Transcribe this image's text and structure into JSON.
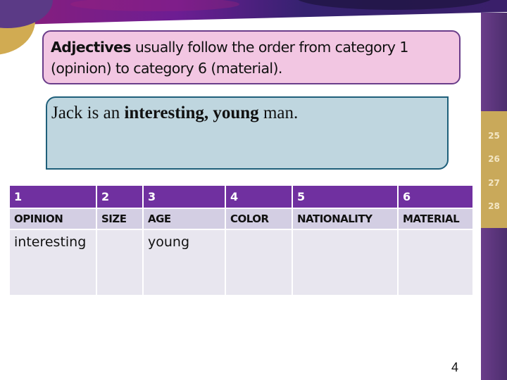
{
  "slide": {
    "rule_text": {
      "bold": "Adjectives",
      "rest": " usually follow the order from category 1 (opinion) to category 6 (material)."
    },
    "example_sentence": {
      "prefix": "Jack is an ",
      "bold": "interesting, young",
      "suffix": " man."
    },
    "table": {
      "numbers": [
        "1",
        "2",
        "3",
        "4",
        "5",
        "6"
      ],
      "categories": [
        "OPINION",
        "SIZE",
        "AGE",
        "COLOR",
        "NATIONALITY",
        "MATERIAL"
      ],
      "words": [
        "interesting",
        "",
        "young",
        "",
        "",
        ""
      ]
    },
    "page_number": "4"
  },
  "sidebar": {
    "numbers": [
      "25",
      "26",
      "27",
      "28"
    ]
  },
  "colors": {
    "table_header": "#7030a0",
    "category_row": "#d3cee3",
    "word_row": "#e8e6ef",
    "rule_box_bg": "#f2c6e2",
    "rule_box_border": "#6a3d8a",
    "example_box_bg": "#bfd6df",
    "example_box_border": "#1f5f7a",
    "sidebar_gold": "#c9a95a",
    "sidebar_purple": "#5a3478"
  }
}
